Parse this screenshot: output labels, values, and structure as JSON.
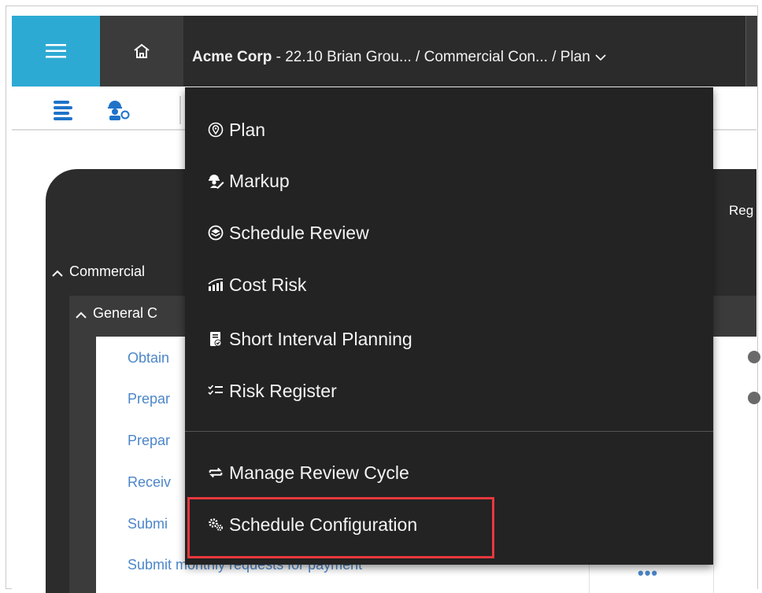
{
  "header": {
    "company": "Acme Corp",
    "crumb_rest": " - 22.10 Brian Grou...  / Commercial Con...  / Plan"
  },
  "background": {
    "right_header_label": "Reg",
    "group_commercial": "Commercial",
    "group_general": "General C",
    "tasks": [
      "Obtain",
      "Prepar",
      "Prepar",
      "Receiv",
      "Submi",
      "Submit monthly requests for payment"
    ]
  },
  "menu": {
    "items": [
      {
        "label": "Plan",
        "icon": "location-pin-icon"
      },
      {
        "label": "Markup",
        "icon": "worker-pen-icon"
      },
      {
        "label": "Schedule Review",
        "icon": "layers-circle-icon"
      },
      {
        "label": "Cost Risk",
        "icon": "chart-bars-icon"
      },
      {
        "label": "Short Interval Planning",
        "icon": "clipboard-check-icon"
      },
      {
        "label": "Risk Register",
        "icon": "checklist-icon"
      },
      {
        "label": "Manage Review Cycle",
        "icon": "swap-arrows-icon"
      },
      {
        "label": "Schedule Configuration",
        "icon": "gears-icon"
      }
    ]
  },
  "colors": {
    "hamburger_bg": "#2daad4",
    "menu_bg": "#232323",
    "highlight": "#e8383d",
    "link": "#4c86c9"
  }
}
